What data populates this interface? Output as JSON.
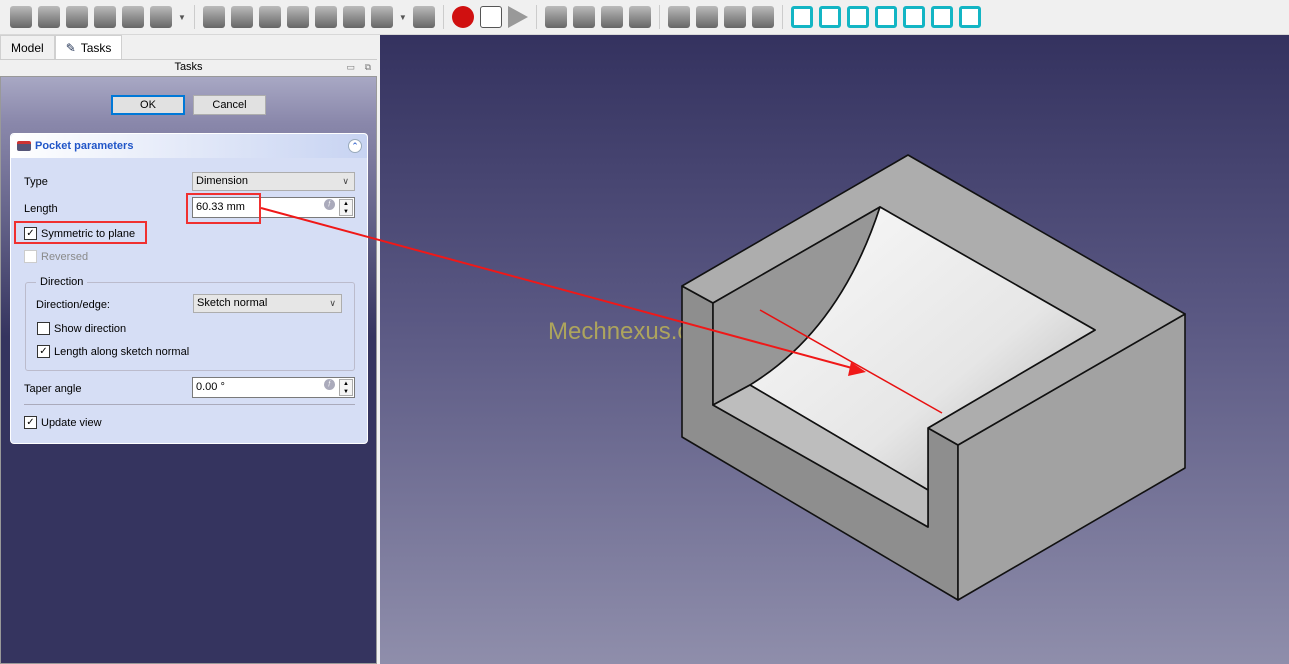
{
  "toolbar": {
    "icons": [
      "pad-icon",
      "revolution-icon",
      "additive-loft-icon",
      "additive-pipe-icon",
      "additive-helix-icon",
      "additive-primitive-icon",
      "pocket-icon",
      "hole-icon",
      "groove-icon",
      "subtractive-loft-icon",
      "subtractive-pipe-icon",
      "subtractive-helix-icon",
      "subtractive-primitive-icon",
      "boolean-icon",
      "record-macro-icon",
      "macro-editor-icon",
      "execute-macro-icon",
      "fillet-icon",
      "chamfer-icon",
      "draft-icon",
      "thickness-icon",
      "mirrored-icon",
      "linear-pattern-icon",
      "polar-pattern-icon",
      "multitransform-icon",
      "view-fit-all-icon",
      "view-front-icon",
      "view-top-icon",
      "view-right-icon",
      "view-rear-icon",
      "view-bottom-icon",
      "view-left-icon"
    ]
  },
  "tabs": {
    "model": "Model",
    "tasks": "Tasks"
  },
  "panel_title": "Tasks",
  "buttons": {
    "ok": "OK",
    "cancel": "Cancel"
  },
  "pocket": {
    "title": "Pocket parameters",
    "type_label": "Type",
    "type_value": "Dimension",
    "length_label": "Length",
    "length_value": "60.33 mm",
    "symmetric_label": "Symmetric to plane",
    "symmetric_checked": true,
    "reversed_label": "Reversed",
    "reversed_checked": false,
    "direction_group": "Direction",
    "direction_edge_label": "Direction/edge:",
    "direction_edge_value": "Sketch normal",
    "show_direction_label": "Show direction",
    "show_direction_checked": false,
    "length_along_label": "Length along sketch normal",
    "length_along_checked": true,
    "taper_label": "Taper angle",
    "taper_value": "0.00 °",
    "update_view_label": "Update view",
    "update_view_checked": true
  },
  "watermark": "Mechnexus.com",
  "colors": {
    "highlight": "#f03030",
    "accent": "#2156c8",
    "view_icons": "#13b5c4"
  }
}
